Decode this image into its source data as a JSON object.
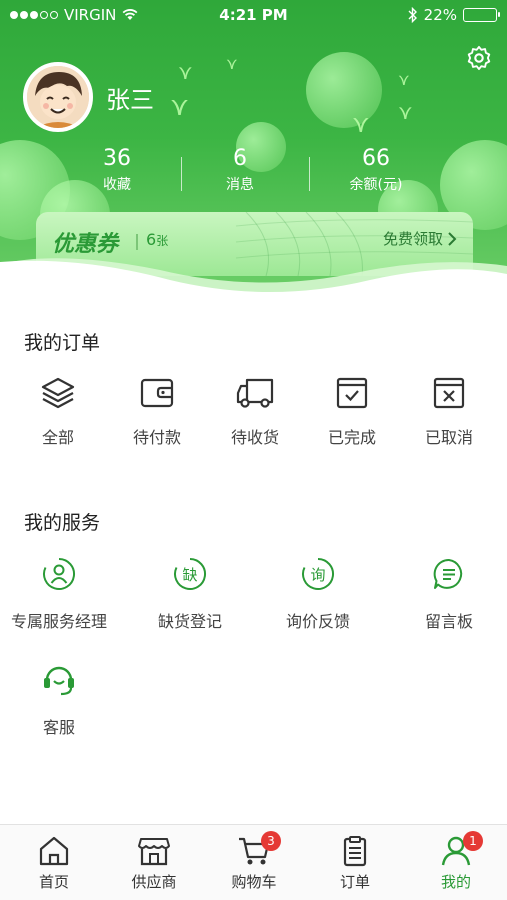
{
  "status_bar": {
    "carrier": "VIRGIN",
    "time": "4:21 PM",
    "battery": "22%",
    "battery_level": 0.22,
    "icons": [
      "signal-dots-icon",
      "wifi-icon",
      "bluetooth-icon",
      "battery-icon"
    ]
  },
  "profile": {
    "username": "张三",
    "avatar_icon": "cartoon-avatar",
    "settings_icon": "gear-icon",
    "stats": [
      {
        "value": "36",
        "label": "收藏"
      },
      {
        "value": "6",
        "label": "消息"
      },
      {
        "value": "66",
        "label": "余额(元)"
      }
    ]
  },
  "coupon": {
    "title": "优惠券",
    "count": "6",
    "unit": "张",
    "action": "免费领取"
  },
  "orders": {
    "title": "我的订单",
    "items": [
      {
        "label": "全部",
        "icon": "layers-icon"
      },
      {
        "label": "待付款",
        "icon": "wallet-icon"
      },
      {
        "label": "待收货",
        "icon": "truck-icon"
      },
      {
        "label": "已完成",
        "icon": "check-box-icon"
      },
      {
        "label": "已取消",
        "icon": "cancel-box-icon"
      }
    ]
  },
  "services": {
    "title": "我的服务",
    "items": [
      {
        "label": "专属服务经理",
        "icon": "manager-icon"
      },
      {
        "label": "缺货登记",
        "icon_text": "缺",
        "icon": "shortage-icon"
      },
      {
        "label": "询价反馈",
        "icon_text": "询",
        "icon": "inquiry-icon"
      },
      {
        "label": "留言板",
        "icon": "message-board-icon"
      },
      {
        "label": "客服",
        "icon": "headset-icon"
      }
    ]
  },
  "tabbar": {
    "items": [
      {
        "label": "首页",
        "icon": "home-icon"
      },
      {
        "label": "供应商",
        "icon": "store-icon"
      },
      {
        "label": "购物车",
        "icon": "cart-icon",
        "badge": "3"
      },
      {
        "label": "订单",
        "icon": "clipboard-icon"
      },
      {
        "label": "我的",
        "icon": "user-icon",
        "badge": "1"
      }
    ],
    "active_index": 4
  },
  "colors": {
    "brand_green": "#2fa83a",
    "active_tab": "#2a9a36",
    "badge_red": "#e53935"
  }
}
